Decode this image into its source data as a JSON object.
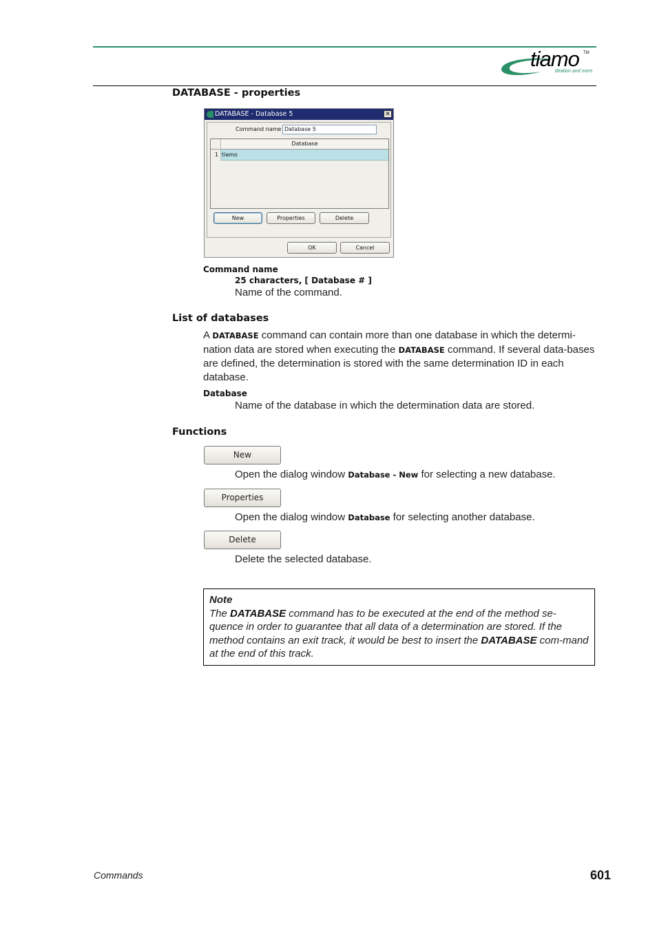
{
  "header": {
    "logo_word": "tiamo",
    "logo_tm": "TM",
    "logo_tagline": "titration and more",
    "brand_color": "#2a8f66"
  },
  "section_title": "DATABASE - properties",
  "dialog": {
    "title": "DATABASE - Database 5",
    "close_icon": "close-x",
    "command_name_label": "Command name",
    "command_name_value": "Database 5",
    "grid": {
      "column_header": "Database",
      "rows": [
        {
          "num": "1",
          "value": "tiamo"
        }
      ]
    },
    "buttons": {
      "new": "New",
      "properties": "Properties",
      "delete": "Delete",
      "ok": "OK",
      "cancel": "Cancel"
    }
  },
  "command_name": {
    "label": "Command name",
    "spec": "25 characters, [ Database # ]",
    "desc": "Name of the command."
  },
  "list_of_databases": {
    "heading": "List of databases",
    "para_1": "A ",
    "kw_1": "DATABASE",
    "para_2": " command can contain more than one database in which the determi-nation data are stored when executing the ",
    "kw_2": "DATABASE",
    "para_3": " command. If several data-bases are defined, the determination is stored with the same determination ID in each database.",
    "field_label": "Database",
    "field_desc": "Name of the database in which the determination data are stored."
  },
  "functions": {
    "heading": "Functions",
    "items": [
      {
        "button": "New",
        "desc_pre": "Open the dialog window ",
        "desc_kw": "Database - New",
        "desc_post": " for selecting a new database."
      },
      {
        "button": "Properties",
        "desc_pre": "Open the dialog window ",
        "desc_kw": "Database",
        "desc_post": " for selecting another database."
      },
      {
        "button": "Delete",
        "desc_pre": "Delete the selected database.",
        "desc_kw": "",
        "desc_post": ""
      }
    ]
  },
  "note": {
    "title": "Note",
    "t1": "The ",
    "kw1": "DATABASE",
    "t2": " command has to be executed at the end of the method se-quence in order to guarantee that all data of a determination are stored. If the method contains an exit track, it would be best to insert the ",
    "kw2": "DATABASE",
    "t3": " com-mand at the end of this track."
  },
  "footer": {
    "section": "Commands",
    "page_number": "601"
  }
}
